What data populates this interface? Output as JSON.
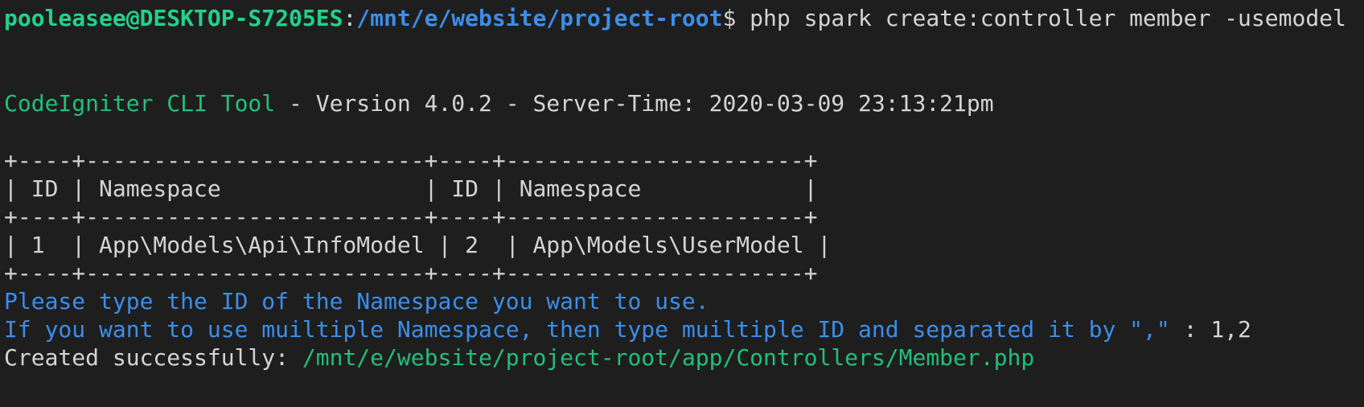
{
  "terminal": {
    "prompt": {
      "user_host": "pooleasee@DESKTOP-S7205ES",
      "colon": ":",
      "path": "/mnt/e/website/project-root",
      "dollar": "$",
      "command": " php spark create:controller member -usemodel"
    },
    "banner": {
      "tool_name": "CodeIgniter CLI Tool",
      "details": " - Version 4.0.2 - Server-Time: 2020-03-09 23:13:21pm"
    },
    "table": {
      "border_line": "+----+-------------------------+----+----------------------+",
      "header_row": "| ID | Namespace               | ID | Namespace            |",
      "data_row": "| 1  | App\\Models\\Api\\InfoModel | 2  | App\\Models\\UserModel |"
    },
    "instructions": {
      "line1": "Please type the ID of the Namespace you want to use.",
      "line2": "If you want to use muiltiple Namespace, then type muiltiple ID and separated it by \",\" ",
      "line2_input": ": 1,2"
    },
    "result": {
      "label": "Created successfully: ",
      "path": "/mnt/e/website/project-root/app/Controllers/Member.php"
    },
    "colors": {
      "background": "#1e1e1e",
      "green": "#23d18b",
      "blue": "#3b8eea",
      "text": "#d4d4d4"
    }
  }
}
